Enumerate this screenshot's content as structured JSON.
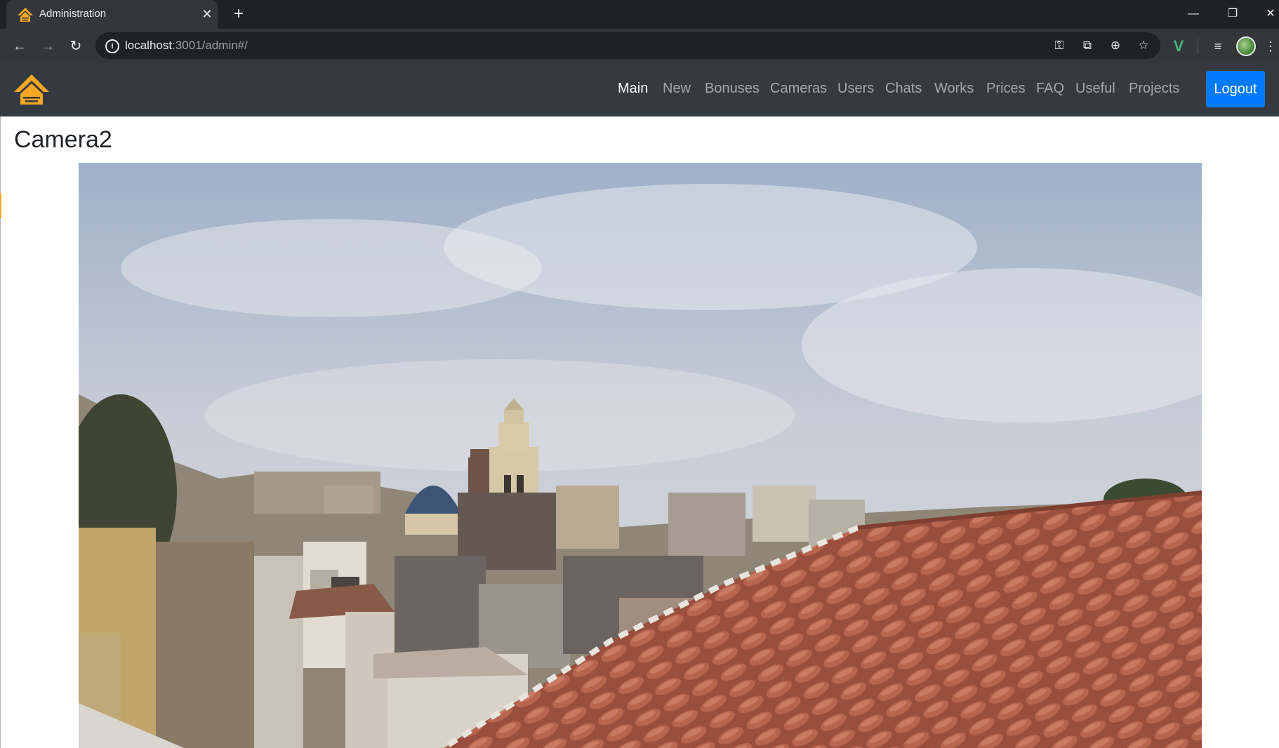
{
  "browser": {
    "tab_title": "Administration",
    "url_host": "localhost",
    "url_rest": ":3001/admin#/"
  },
  "navbar": {
    "items": [
      {
        "label": "Main",
        "active": true
      },
      {
        "label": "New",
        "active": false
      },
      {
        "label": "Bonuses",
        "active": false
      },
      {
        "label": "Cameras",
        "active": false
      },
      {
        "label": "Users",
        "active": false
      },
      {
        "label": "Chats",
        "active": false
      },
      {
        "label": "Works",
        "active": false
      },
      {
        "label": "Prices",
        "active": false
      },
      {
        "label": "FAQ",
        "active": false
      },
      {
        "label": "Useful",
        "active": false
      },
      {
        "label": "Projects",
        "active": false
      }
    ],
    "logout_label": "Logout"
  },
  "page": {
    "title": "Camera2"
  },
  "colors": {
    "navbar_bg": "#343a40",
    "accent": "#007bff",
    "brand_orange": "#f5a623"
  },
  "icons": {
    "tab": [
      "brand-logo-icon",
      "close-icon",
      "plus-icon"
    ],
    "window": [
      "minimize-icon",
      "restore-icon",
      "close-icon"
    ],
    "toolbar": [
      "back-arrow-icon",
      "forward-arrow-icon",
      "reload-icon",
      "info-icon",
      "key-icon",
      "open-external-icon",
      "add-circle-icon",
      "star-icon",
      "vue-devtools-icon",
      "media-queue-icon",
      "profile-avatar-icon",
      "more-vert-icon"
    ]
  }
}
